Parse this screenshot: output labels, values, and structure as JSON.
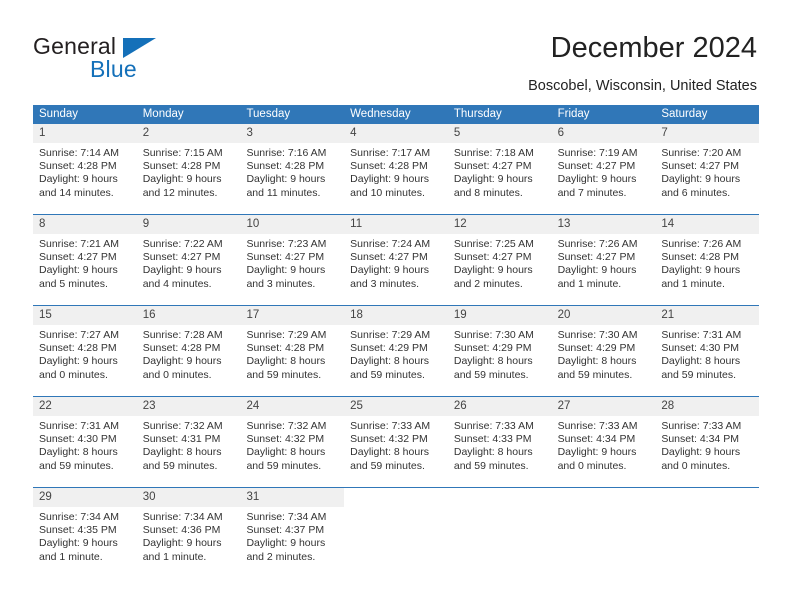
{
  "brand": {
    "name_top": "General",
    "name_bottom": "Blue",
    "accent_color": "#1470b9"
  },
  "header": {
    "title": "December 2024",
    "subtitle": "Boscobel, Wisconsin, United States"
  },
  "theme": {
    "header_blue": "#3077b8",
    "daynum_band": "#f0f0f0",
    "text": "#333333"
  },
  "calendar": {
    "weekdays": [
      "Sunday",
      "Monday",
      "Tuesday",
      "Wednesday",
      "Thursday",
      "Friday",
      "Saturday"
    ],
    "weeks": [
      [
        {
          "day": "1",
          "sunrise": "Sunrise: 7:14 AM",
          "sunset": "Sunset: 4:28 PM",
          "daylight1": "Daylight: 9 hours",
          "daylight2": "and 14 minutes."
        },
        {
          "day": "2",
          "sunrise": "Sunrise: 7:15 AM",
          "sunset": "Sunset: 4:28 PM",
          "daylight1": "Daylight: 9 hours",
          "daylight2": "and 12 minutes."
        },
        {
          "day": "3",
          "sunrise": "Sunrise: 7:16 AM",
          "sunset": "Sunset: 4:28 PM",
          "daylight1": "Daylight: 9 hours",
          "daylight2": "and 11 minutes."
        },
        {
          "day": "4",
          "sunrise": "Sunrise: 7:17 AM",
          "sunset": "Sunset: 4:28 PM",
          "daylight1": "Daylight: 9 hours",
          "daylight2": "and 10 minutes."
        },
        {
          "day": "5",
          "sunrise": "Sunrise: 7:18 AM",
          "sunset": "Sunset: 4:27 PM",
          "daylight1": "Daylight: 9 hours",
          "daylight2": "and 8 minutes."
        },
        {
          "day": "6",
          "sunrise": "Sunrise: 7:19 AM",
          "sunset": "Sunset: 4:27 PM",
          "daylight1": "Daylight: 9 hours",
          "daylight2": "and 7 minutes."
        },
        {
          "day": "7",
          "sunrise": "Sunrise: 7:20 AM",
          "sunset": "Sunset: 4:27 PM",
          "daylight1": "Daylight: 9 hours",
          "daylight2": "and 6 minutes."
        }
      ],
      [
        {
          "day": "8",
          "sunrise": "Sunrise: 7:21 AM",
          "sunset": "Sunset: 4:27 PM",
          "daylight1": "Daylight: 9 hours",
          "daylight2": "and 5 minutes."
        },
        {
          "day": "9",
          "sunrise": "Sunrise: 7:22 AM",
          "sunset": "Sunset: 4:27 PM",
          "daylight1": "Daylight: 9 hours",
          "daylight2": "and 4 minutes."
        },
        {
          "day": "10",
          "sunrise": "Sunrise: 7:23 AM",
          "sunset": "Sunset: 4:27 PM",
          "daylight1": "Daylight: 9 hours",
          "daylight2": "and 3 minutes."
        },
        {
          "day": "11",
          "sunrise": "Sunrise: 7:24 AM",
          "sunset": "Sunset: 4:27 PM",
          "daylight1": "Daylight: 9 hours",
          "daylight2": "and 3 minutes."
        },
        {
          "day": "12",
          "sunrise": "Sunrise: 7:25 AM",
          "sunset": "Sunset: 4:27 PM",
          "daylight1": "Daylight: 9 hours",
          "daylight2": "and 2 minutes."
        },
        {
          "day": "13",
          "sunrise": "Sunrise: 7:26 AM",
          "sunset": "Sunset: 4:27 PM",
          "daylight1": "Daylight: 9 hours",
          "daylight2": "and 1 minute."
        },
        {
          "day": "14",
          "sunrise": "Sunrise: 7:26 AM",
          "sunset": "Sunset: 4:28 PM",
          "daylight1": "Daylight: 9 hours",
          "daylight2": "and 1 minute."
        }
      ],
      [
        {
          "day": "15",
          "sunrise": "Sunrise: 7:27 AM",
          "sunset": "Sunset: 4:28 PM",
          "daylight1": "Daylight: 9 hours",
          "daylight2": "and 0 minutes."
        },
        {
          "day": "16",
          "sunrise": "Sunrise: 7:28 AM",
          "sunset": "Sunset: 4:28 PM",
          "daylight1": "Daylight: 9 hours",
          "daylight2": "and 0 minutes."
        },
        {
          "day": "17",
          "sunrise": "Sunrise: 7:29 AM",
          "sunset": "Sunset: 4:28 PM",
          "daylight1": "Daylight: 8 hours",
          "daylight2": "and 59 minutes."
        },
        {
          "day": "18",
          "sunrise": "Sunrise: 7:29 AM",
          "sunset": "Sunset: 4:29 PM",
          "daylight1": "Daylight: 8 hours",
          "daylight2": "and 59 minutes."
        },
        {
          "day": "19",
          "sunrise": "Sunrise: 7:30 AM",
          "sunset": "Sunset: 4:29 PM",
          "daylight1": "Daylight: 8 hours",
          "daylight2": "and 59 minutes."
        },
        {
          "day": "20",
          "sunrise": "Sunrise: 7:30 AM",
          "sunset": "Sunset: 4:29 PM",
          "daylight1": "Daylight: 8 hours",
          "daylight2": "and 59 minutes."
        },
        {
          "day": "21",
          "sunrise": "Sunrise: 7:31 AM",
          "sunset": "Sunset: 4:30 PM",
          "daylight1": "Daylight: 8 hours",
          "daylight2": "and 59 minutes."
        }
      ],
      [
        {
          "day": "22",
          "sunrise": "Sunrise: 7:31 AM",
          "sunset": "Sunset: 4:30 PM",
          "daylight1": "Daylight: 8 hours",
          "daylight2": "and 59 minutes."
        },
        {
          "day": "23",
          "sunrise": "Sunrise: 7:32 AM",
          "sunset": "Sunset: 4:31 PM",
          "daylight1": "Daylight: 8 hours",
          "daylight2": "and 59 minutes."
        },
        {
          "day": "24",
          "sunrise": "Sunrise: 7:32 AM",
          "sunset": "Sunset: 4:32 PM",
          "daylight1": "Daylight: 8 hours",
          "daylight2": "and 59 minutes."
        },
        {
          "day": "25",
          "sunrise": "Sunrise: 7:33 AM",
          "sunset": "Sunset: 4:32 PM",
          "daylight1": "Daylight: 8 hours",
          "daylight2": "and 59 minutes."
        },
        {
          "day": "26",
          "sunrise": "Sunrise: 7:33 AM",
          "sunset": "Sunset: 4:33 PM",
          "daylight1": "Daylight: 8 hours",
          "daylight2": "and 59 minutes."
        },
        {
          "day": "27",
          "sunrise": "Sunrise: 7:33 AM",
          "sunset": "Sunset: 4:34 PM",
          "daylight1": "Daylight: 9 hours",
          "daylight2": "and 0 minutes."
        },
        {
          "day": "28",
          "sunrise": "Sunrise: 7:33 AM",
          "sunset": "Sunset: 4:34 PM",
          "daylight1": "Daylight: 9 hours",
          "daylight2": "and 0 minutes."
        }
      ],
      [
        {
          "day": "29",
          "sunrise": "Sunrise: 7:34 AM",
          "sunset": "Sunset: 4:35 PM",
          "daylight1": "Daylight: 9 hours",
          "daylight2": "and 1 minute."
        },
        {
          "day": "30",
          "sunrise": "Sunrise: 7:34 AM",
          "sunset": "Sunset: 4:36 PM",
          "daylight1": "Daylight: 9 hours",
          "daylight2": "and 1 minute."
        },
        {
          "day": "31",
          "sunrise": "Sunrise: 7:34 AM",
          "sunset": "Sunset: 4:37 PM",
          "daylight1": "Daylight: 9 hours",
          "daylight2": "and 2 minutes."
        },
        {
          "day": "",
          "sunrise": "",
          "sunset": "",
          "daylight1": "",
          "daylight2": ""
        },
        {
          "day": "",
          "sunrise": "",
          "sunset": "",
          "daylight1": "",
          "daylight2": ""
        },
        {
          "day": "",
          "sunrise": "",
          "sunset": "",
          "daylight1": "",
          "daylight2": ""
        },
        {
          "day": "",
          "sunrise": "",
          "sunset": "",
          "daylight1": "",
          "daylight2": ""
        }
      ]
    ]
  }
}
